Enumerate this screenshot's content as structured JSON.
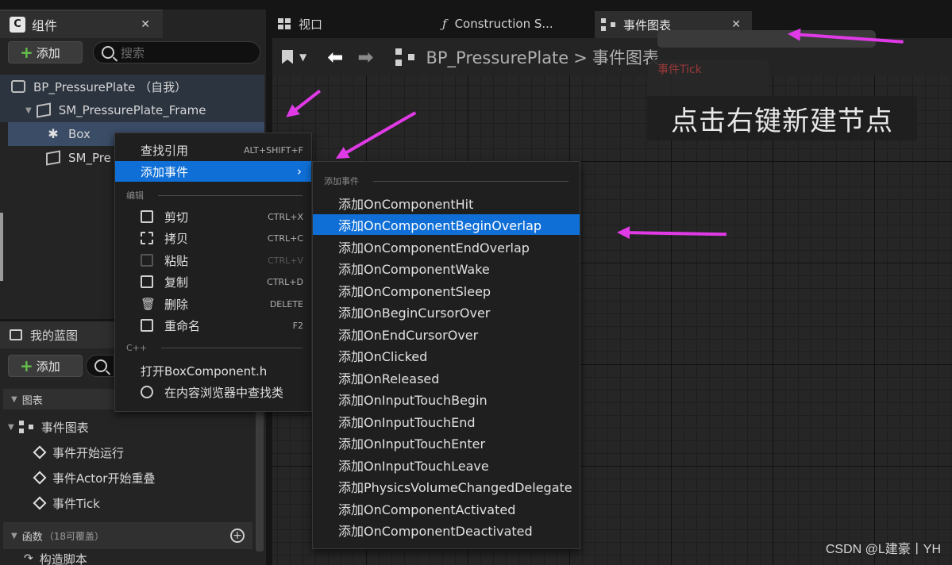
{
  "tabs": {
    "components": "组件",
    "viewport": "视口",
    "construction": "Construction S...",
    "event_graph": "事件图表"
  },
  "components_panel": {
    "add_label": "添加",
    "search_placeholder": "搜索",
    "tree": [
      {
        "label": "BP_PressurePlate （自我）"
      },
      {
        "label": "SM_PressurePlate_Frame"
      },
      {
        "label": "Box"
      },
      {
        "label": "SM_Pre"
      }
    ]
  },
  "graph": {
    "breadcrumb_root": "BP_PressurePlate",
    "breadcrumb_separator": ">",
    "breadcrumb_leaf": "事件图表",
    "bg_node_title": "事件Tick",
    "hint": "点击右键新建节点"
  },
  "blueprint_panel": {
    "title": "我的蓝图",
    "add_label": "添加",
    "section_graphs": "图表",
    "event_graph": "事件图表",
    "events": [
      "事件开始运行",
      "事件Actor开始重叠",
      "事件Tick"
    ],
    "section_functions": "函数",
    "functions_note": "（18可覆盖）",
    "construct_script": "构造脚本"
  },
  "context_menu": {
    "find_refs": {
      "label": "查找引用",
      "shortcut": "ALT+SHIFT+F"
    },
    "add_event": {
      "label": "添加事件"
    },
    "section_edit": "编辑",
    "edit_items": [
      {
        "label": "剪切",
        "shortcut": "CTRL+X"
      },
      {
        "label": "拷贝",
        "shortcut": "CTRL+C"
      },
      {
        "label": "粘贴",
        "shortcut": "CTRL+V"
      },
      {
        "label": "复制",
        "shortcut": "CTRL+D"
      },
      {
        "label": "删除",
        "shortcut": "DELETE"
      },
      {
        "label": "重命名",
        "shortcut": "F2"
      }
    ],
    "section_cpp": "C++",
    "open_header": "打开BoxComponent.h",
    "find_in_browser": "在内容浏览器中查找类"
  },
  "sub_menu": {
    "section": "添加事件",
    "items": [
      "添加OnComponentHit",
      "添加OnComponentBeginOverlap",
      "添加OnComponentEndOverlap",
      "添加OnComponentWake",
      "添加OnComponentSleep",
      "添加OnBeginCursorOver",
      "添加OnEndCursorOver",
      "添加OnClicked",
      "添加OnReleased",
      "添加OnInputTouchBegin",
      "添加OnInputTouchEnd",
      "添加OnInputTouchEnter",
      "添加OnInputTouchLeave",
      "添加PhysicsVolumeChangedDelegate",
      "添加OnComponentActivated",
      "添加OnComponentDeactivated"
    ],
    "selected_index": 1
  },
  "watermark": "CSDN @L建豪丨YH",
  "colors": {
    "accent": "#0f6fd6",
    "annotation": "#e03ae6",
    "add_plus": "#66c04a"
  }
}
